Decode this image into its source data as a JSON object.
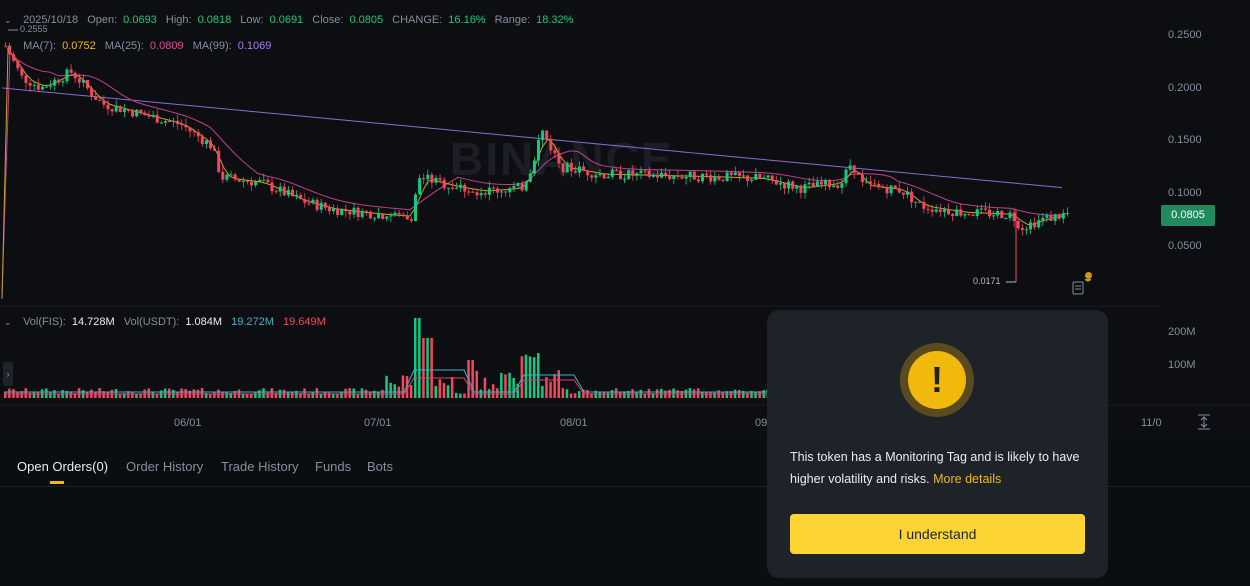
{
  "ohlc": {
    "date": "2025/10/18",
    "open_label": "Open:",
    "open": "0.0693",
    "high_label": "High:",
    "high": "0.0818",
    "low_label": "Low:",
    "low": "0.0691",
    "close_label": "Close:",
    "close": "0.0805",
    "change_label": "CHANGE:",
    "change": "16.16%",
    "range_label": "Range:",
    "range": "18.32%"
  },
  "ma": {
    "ma7_label": "MA(7):",
    "ma7": "0.0752",
    "ma25_label": "MA(25):",
    "ma25": "0.0809",
    "ma99_label": "MA(99):",
    "ma99": "0.1069"
  },
  "volume": {
    "vol_fis_label": "Vol(FIS):",
    "vol_fis": "14.728M",
    "vol_usdt_label": "Vol(USDT):",
    "vol_usdt": "1.084M",
    "v1": "19.272M",
    "v2": "19.649M",
    "axis": [
      "200M",
      "100M"
    ]
  },
  "price_axis": [
    "0.2500",
    "0.2000",
    "0.1500",
    "0.1000",
    "0.0500"
  ],
  "current_price": "0.0805",
  "high_marker": "0.2555",
  "low_marker": "0.0171",
  "time_axis": [
    "06/01",
    "07/01",
    "08/01",
    "09",
    "11/0"
  ],
  "watermark": "BINANCE",
  "tabs": [
    {
      "label": "Open Orders(0)"
    },
    {
      "label": "Order History"
    },
    {
      "label": "Trade History"
    },
    {
      "label": "Funds"
    },
    {
      "label": "Bots"
    }
  ],
  "modal": {
    "message": "This token has a Monitoring Tag and is likely to have higher volatility and risks.",
    "link": "More details",
    "button": "I understand",
    "icon": "!"
  },
  "colors": {
    "up": "#0ecb81",
    "down": "#f6465d",
    "accent": "#fcd535"
  }
}
